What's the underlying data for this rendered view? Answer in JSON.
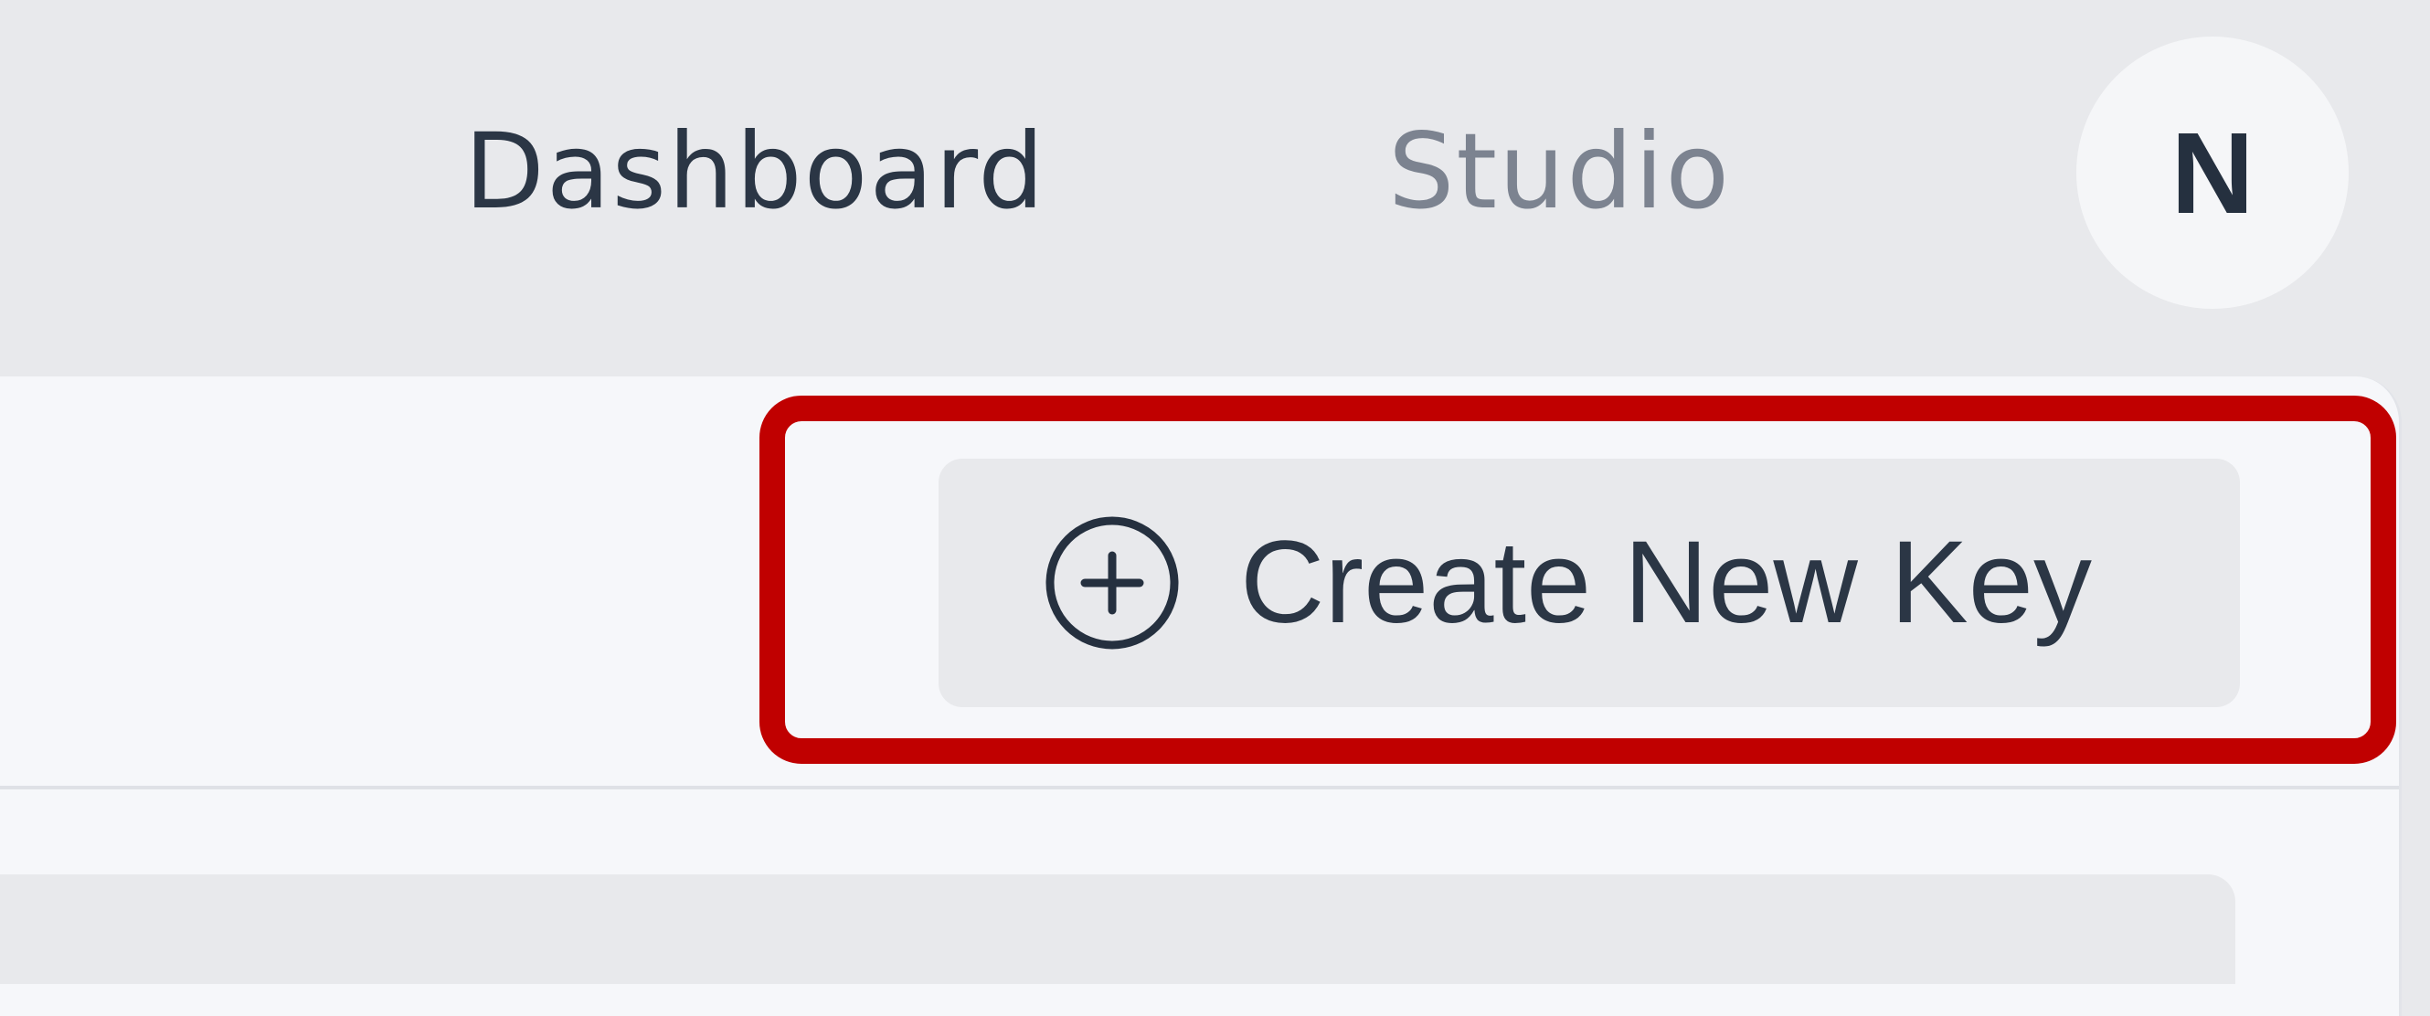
{
  "nav": {
    "dashboard_label": "Dashboard",
    "studio_label": "Studio",
    "avatar_initial": "N"
  },
  "toolbar": {
    "create_key_label": "Create New Key",
    "create_key_icon": "plus-circle-icon"
  },
  "colors": {
    "page_background": "#e8e9ec",
    "panel_background": "#f6f7fa",
    "text_primary": "#2b3645",
    "text_muted": "#7c8390",
    "highlight": "#c00000"
  }
}
